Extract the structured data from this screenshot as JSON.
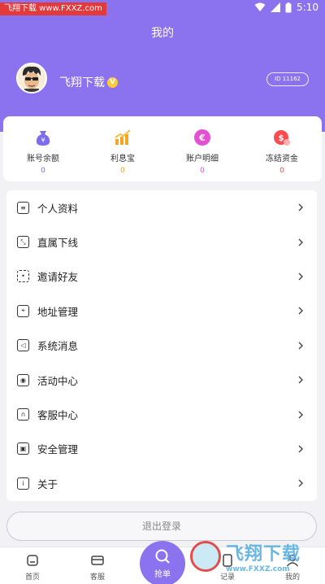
{
  "status_bar": {
    "watermark_text": "飞翔下载 www.FXXZ.com",
    "time": "5:10"
  },
  "header": {
    "title": "我的",
    "username": "飞翔下载",
    "vip_badge": "V",
    "id_label": "ID 11162"
  },
  "stats": [
    {
      "label": "账号余额",
      "value": "0",
      "icon": "wallet-icon",
      "color": "#7b6cf0"
    },
    {
      "label": "利息宝",
      "value": "0",
      "icon": "chart-icon",
      "color": "#f5a623"
    },
    {
      "label": "账户明细",
      "value": "0",
      "icon": "statement-icon",
      "color": "#e64fd2"
    },
    {
      "label": "冻结资金",
      "value": "0",
      "icon": "frozen-funds-icon",
      "color": "#ff4d4f"
    }
  ],
  "menu": [
    {
      "label": "个人资料",
      "icon": "profile-icon"
    },
    {
      "label": "直属下线",
      "icon": "team-icon"
    },
    {
      "label": "邀请好友",
      "icon": "invite-icon"
    },
    {
      "label": "地址管理",
      "icon": "address-icon"
    },
    {
      "label": "系统消息",
      "icon": "message-icon"
    },
    {
      "label": "活动中心",
      "icon": "activity-icon"
    },
    {
      "label": "客服中心",
      "icon": "support-icon"
    },
    {
      "label": "安全管理",
      "icon": "security-icon"
    },
    {
      "label": "关于",
      "icon": "info-icon"
    }
  ],
  "logout_label": "退出登录",
  "tabs": [
    {
      "label": "首页",
      "icon": "home-icon"
    },
    {
      "label": "客服",
      "icon": "service-icon"
    },
    {
      "label": "抢单",
      "icon": "grab-order-icon"
    },
    {
      "label": "记录",
      "icon": "records-icon"
    },
    {
      "label": "我的",
      "icon": "mine-icon"
    }
  ],
  "watermark": {
    "big": "飞翔下载",
    "small": "www.FXXZ.com"
  },
  "colors": {
    "primary": "#8b73f0",
    "background": "#f2f2f5"
  }
}
